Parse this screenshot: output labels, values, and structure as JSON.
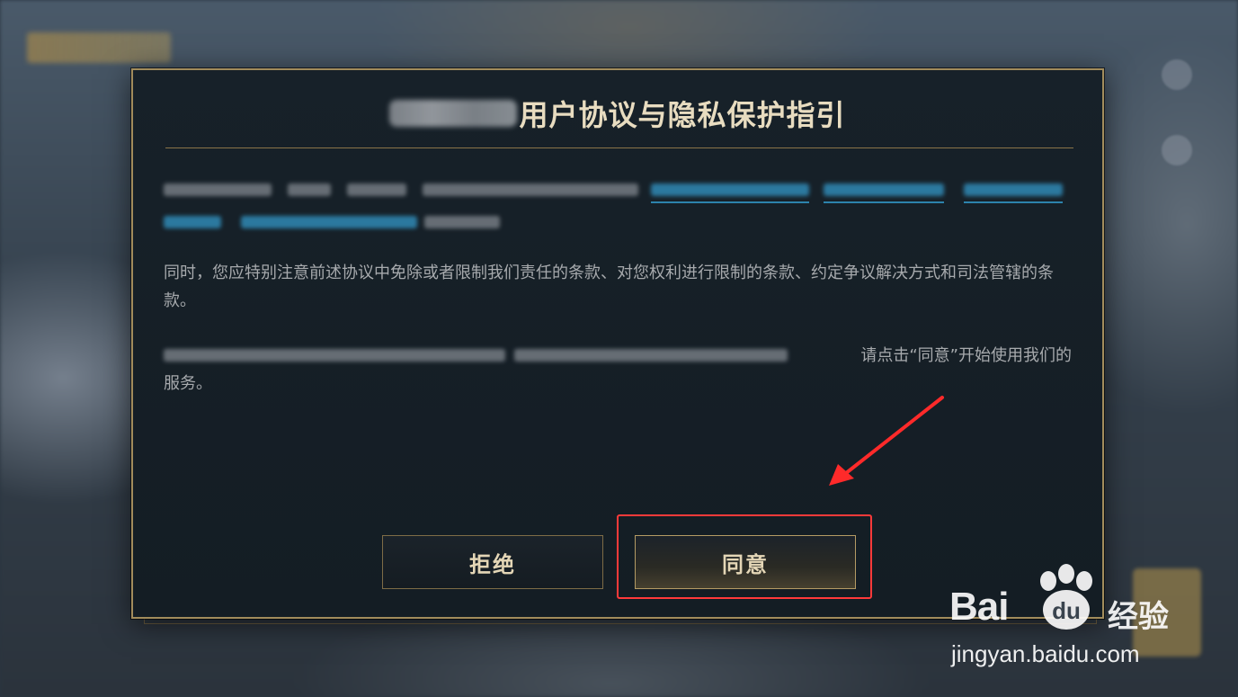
{
  "dialog": {
    "title_suffix": "用户协议与隐私保护指引",
    "paragraph2": "同时，您应特别注意前述协议中免除或者限制我们责任的条款、对您权利进行限制的条款、约定争议解决方式和司法管辖的条款。",
    "paragraph3_visible": "请点击“同意”开始使用我们的",
    "paragraph3_line2": "服务。",
    "refuse_label": "拒绝",
    "agree_label": "同意"
  },
  "watermark": {
    "brand_left": "Bai",
    "brand_right": "经验",
    "paw_text": "du",
    "url": "jingyan.baidu.com"
  },
  "colors": {
    "accent_gold": "#a28c5c",
    "link_blue": "#2d7ea6",
    "annotation_red": "#ff3a3a"
  }
}
